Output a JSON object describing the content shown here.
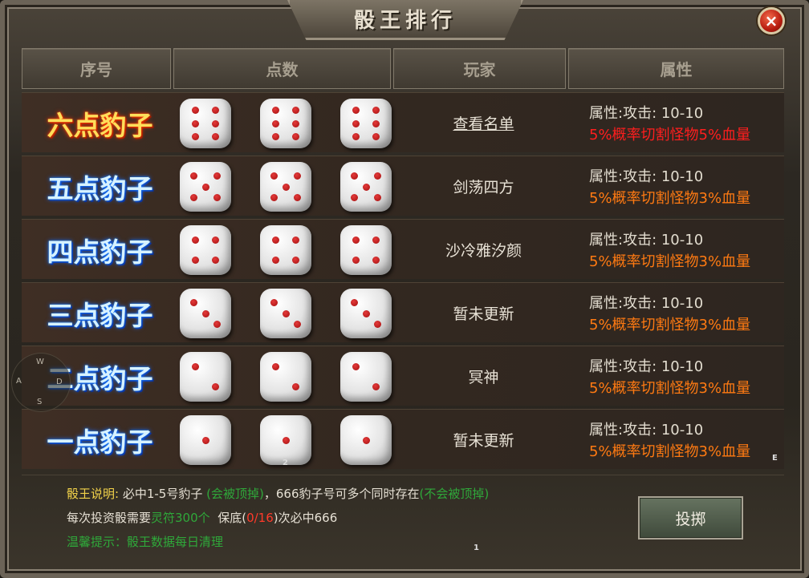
{
  "window": {
    "title": "骰王排行",
    "close_label": "×"
  },
  "header": {
    "col_rank": "序号",
    "col_points": "点数",
    "col_player": "玩家",
    "col_attr": "属性"
  },
  "rows": [
    {
      "rank": "六点豹子",
      "style": "gold",
      "dice": [
        6,
        6,
        6
      ],
      "player": "查看名单",
      "player_link": true,
      "attr_line1": "属性:攻击: 10-10",
      "attr_line2": "5%概率切割怪物5%血量",
      "attr_color": "#ff1e1e"
    },
    {
      "rank": "五点豹子",
      "style": "blue",
      "dice": [
        5,
        5,
        5
      ],
      "player": "剑荡四方",
      "player_link": false,
      "attr_line1": "属性:攻击: 10-10",
      "attr_line2": "5%概率切割怪物3%血量",
      "attr_color": "#ff7a12"
    },
    {
      "rank": "四点豹子",
      "style": "blue",
      "dice": [
        4,
        4,
        4
      ],
      "player": "沙冷雅汐颜",
      "player_link": false,
      "attr_line1": "属性:攻击: 10-10",
      "attr_line2": "5%概率切割怪物3%血量",
      "attr_color": "#ff7a12"
    },
    {
      "rank": "三点豹子",
      "style": "blue",
      "dice": [
        3,
        3,
        3
      ],
      "player": "暂未更新",
      "player_link": false,
      "attr_line1": "属性:攻击: 10-10",
      "attr_line2": "5%概率切割怪物3%血量",
      "attr_color": "#ff7a12"
    },
    {
      "rank": "二点豹子",
      "style": "blue",
      "dice": [
        2,
        2,
        2
      ],
      "player": "冥神",
      "player_link": false,
      "attr_line1": "属性:攻击: 10-10",
      "attr_line2": "5%概率切割怪物3%血量",
      "attr_color": "#ff7a12"
    },
    {
      "rank": "一点豹子",
      "style": "blue",
      "dice": [
        1,
        1,
        1
      ],
      "player": "暂未更新",
      "player_link": false,
      "attr_line1": "属性:攻击: 10-10",
      "attr_line2": "5%概率切割怪物3%血量",
      "attr_color": "#ff7a12"
    }
  ],
  "footer": {
    "desc_label": "骰王说明:",
    "desc_text1": "必中1-5号豹子",
    "desc_green1": "(会被顶掉)",
    "desc_text2": "，666豹子号可多个同时存在",
    "desc_green2": "(不会被顶掉)",
    "cost_text1": "每次投资骰需要",
    "cost_green": "灵符300个",
    "cost_text2": "保底(",
    "cost_red": "0/16",
    "cost_text3": ")次必中666",
    "tip": "温馨提示：骰王数据每日清理",
    "throw_label": "投掷"
  },
  "overlay": {
    "joystick_keys": {
      "up": "W",
      "left": "A",
      "center": "D",
      "down": "S"
    },
    "hint_e": "E",
    "hint_2": "2",
    "hint_1": "1"
  }
}
